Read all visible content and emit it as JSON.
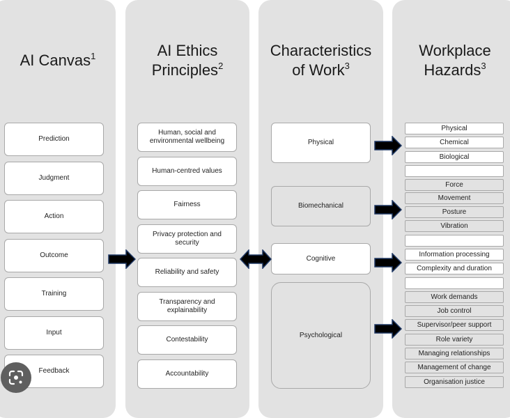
{
  "columns": [
    {
      "title": "AI Canvas",
      "superscript": "1"
    },
    {
      "title_line1": "AI Ethics",
      "title_line2": "Principles",
      "superscript": "2"
    },
    {
      "title_line1": "Characteristics",
      "title_line2": "of Work",
      "superscript": "3"
    },
    {
      "title_line1": "Workplace",
      "title_line2": "Hazards",
      "superscript": "3"
    }
  ],
  "ai_canvas": [
    "Prediction",
    "Judgment",
    "Action",
    "Outcome",
    "Training",
    "Input",
    "Feedback"
  ],
  "ethics_principles": [
    "Human, social and environmental wellbeing",
    "Human-centred values",
    "Fairness",
    "Privacy protection and security",
    "Reliability and safety",
    "Transparency and explainability",
    "Contestability",
    "Accountability"
  ],
  "work_characteristics": [
    "Physical",
    "Biomechanical",
    "Cognitive",
    "Psychological"
  ],
  "hazards": {
    "physical": [
      "Physical",
      "Chemical",
      "Biological",
      ""
    ],
    "biomechanical": [
      "Force",
      "Movement",
      "Posture",
      "Vibration"
    ],
    "cognitive": [
      "",
      "Information processing",
      "Complexity and duration",
      ""
    ],
    "psychological": [
      "Work demands",
      "Job control",
      "Supervisor/peer support",
      "Role variety",
      "Managing relationships",
      "Management of change",
      "Organisation justice"
    ]
  },
  "icons": {
    "arrow": "right-arrow-icon",
    "double_arrow": "double-arrow-icon",
    "lens": "lens-search-icon"
  },
  "colors": {
    "panel": "#e2e2e2",
    "arrow_fill": "#000000",
    "arrow_stroke": "#1f3864"
  }
}
